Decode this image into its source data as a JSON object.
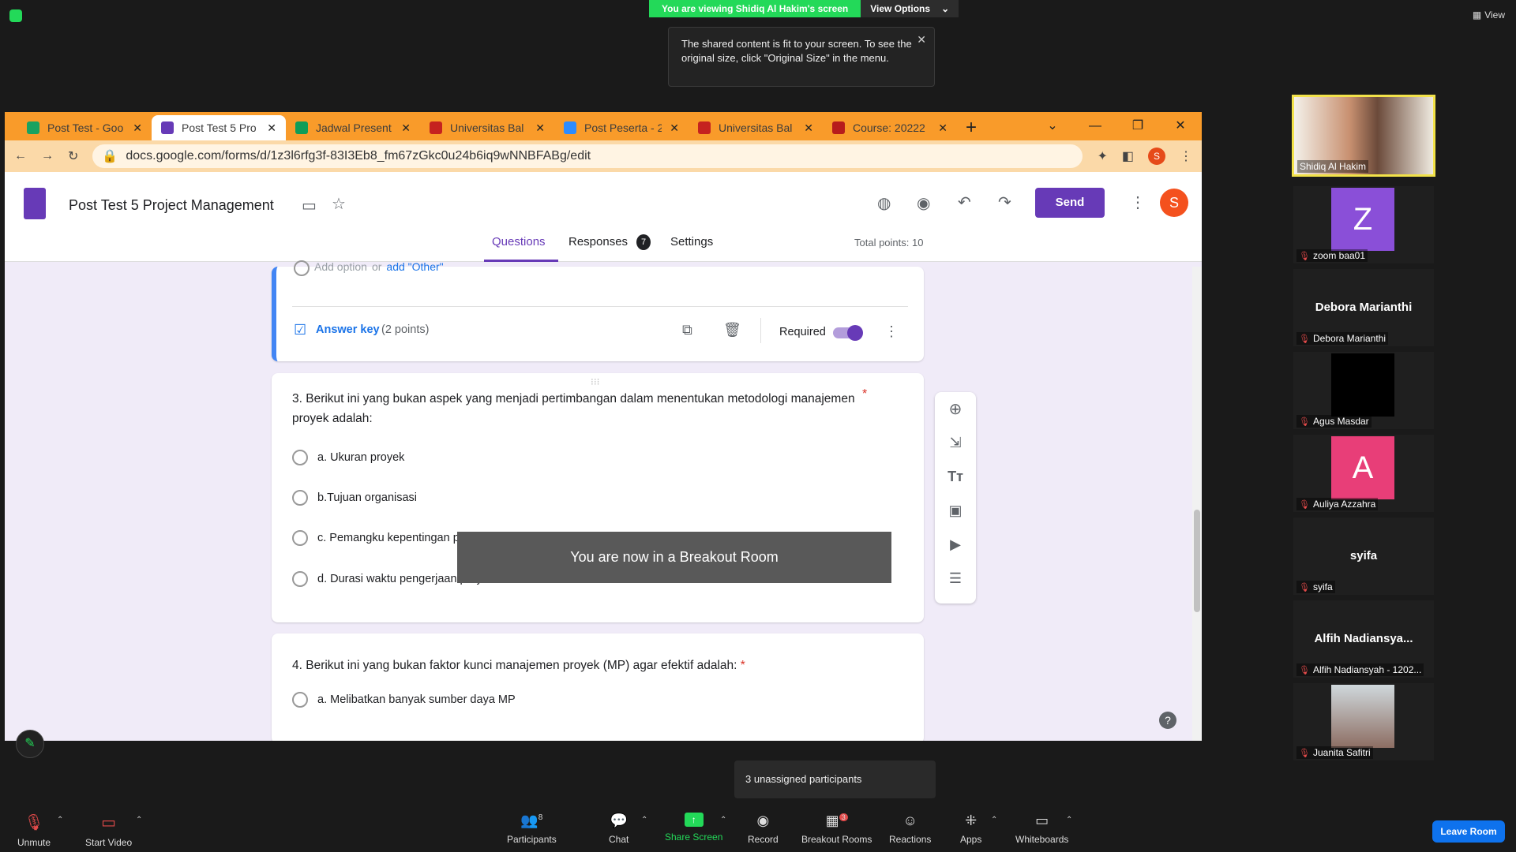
{
  "zoom": {
    "sharing_banner": "You are viewing Shidiq Al Hakim's screen",
    "view_options": "View Options",
    "view_label": "View",
    "tooltip": "The shared content is fit to your screen. To see the original size, click \"Original Size\" in the menu.",
    "breakout_msg": "You are now in a Breakout Room",
    "unassigned": "3 unassigned participants",
    "leave": "Leave Room",
    "toolbar": {
      "unmute": "Unmute",
      "start_video": "Start Video",
      "participants": "Participants",
      "participants_count": "8",
      "chat": "Chat",
      "share": "Share Screen",
      "record": "Record",
      "breakout": "Breakout Rooms",
      "breakout_badge": "3",
      "reactions": "Reactions",
      "apps": "Apps",
      "whiteboards": "Whiteboards"
    }
  },
  "participants": [
    {
      "name": "Shidiq Al Hakim",
      "type": "video"
    },
    {
      "name": "zoom baa01",
      "type": "avatar",
      "letter": "Z",
      "color": "#8a4fd8"
    },
    {
      "name": "Debora Marianthi",
      "type": "text",
      "display": "Debora Marianthi"
    },
    {
      "name": "Agus Masdar",
      "type": "black"
    },
    {
      "name": "Auliya Azzahra",
      "type": "avatar",
      "letter": "A",
      "color": "#e83e78"
    },
    {
      "name": "syifa",
      "type": "text",
      "display": "syifa"
    },
    {
      "name": "Alfih Nadiansyah - 1202...",
      "type": "text",
      "display": "Alfih  Nadiansya..."
    },
    {
      "name": "Juanita Safitri",
      "type": "photo"
    }
  ],
  "browser": {
    "tabs": [
      {
        "title": "Post Test - Goo",
        "color": "#1aa260"
      },
      {
        "title": "Post Test 5 Pro",
        "color": "#673ab7",
        "active": true
      },
      {
        "title": "Jadwal Present",
        "color": "#0f9d58"
      },
      {
        "title": "Universitas Bal",
        "color": "#c5221f"
      },
      {
        "title": "Post Peserta - 2",
        "color": "#2d8cff"
      },
      {
        "title": "Universitas Bal",
        "color": "#c5221f"
      },
      {
        "title": "Course: 20222",
        "color": "#b71c1c"
      }
    ],
    "url": "docs.google.com/forms/d/1z3l6rfg3f-83I3Eb8_fm67zGkc0u24b6iq9wNNBFABg/edit",
    "profile_letter": "S"
  },
  "form": {
    "title": "Post Test 5 Project Management",
    "tab_questions": "Questions",
    "tab_responses": "Responses",
    "responses_count": "7",
    "tab_settings": "Settings",
    "total_points": "Total points: 10",
    "send": "Send",
    "avatar_letter": "S",
    "add_option": "Add option",
    "or": "or",
    "add_other": "add \"Other\"",
    "answer_key": "Answer key",
    "points": "(2 points)",
    "required": "Required",
    "q3": {
      "text": "3. Berikut ini yang  bukan aspek yang menjadi pertimbangan dalam menentukan metodologi manajemen proyek adalah:",
      "options": [
        "a. Ukuran proyek",
        "b.Tujuan organisasi",
        "c. Pemangku kepentingan proyek",
        "d. Durasi waktu pengerjaan proyek"
      ]
    },
    "q4": {
      "text": "4. Berikut ini yang bukan faktor kunci manajemen proyek (MP) agar efektif adalah:",
      "options": [
        "a. Melibatkan banyak sumber daya MP"
      ]
    }
  },
  "colors": {
    "purple": "#673ab7",
    "chrome_tab": "#f99b2a",
    "zoom_green": "#23d959"
  }
}
